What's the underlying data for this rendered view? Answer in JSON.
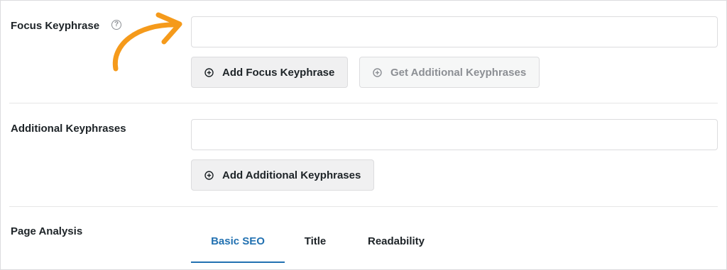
{
  "focus_keyphrase": {
    "label": "Focus Keyphrase",
    "help_icon": "question-mark-icon",
    "input_value": "",
    "input_placeholder": "",
    "add_button_label": "Add Focus Keyphrase",
    "get_additional_button_label": "Get Additional Keyphrases"
  },
  "additional_keyphrases": {
    "label": "Additional Keyphrases",
    "input_value": "",
    "input_placeholder": "",
    "add_button_label": "Add Additional Keyphrases"
  },
  "page_analysis": {
    "label": "Page Analysis",
    "tabs": [
      {
        "label": "Basic SEO",
        "active": true
      },
      {
        "label": "Title",
        "active": false
      },
      {
        "label": "Readability",
        "active": false
      }
    ]
  },
  "colors": {
    "accent": "#2271b1",
    "arrow": "#f59a1b",
    "button_bg": "#f0f0f1",
    "border": "#dcdcde"
  },
  "icons": {
    "add": "plus-circle-icon",
    "annotation": "curved-arrow-icon"
  }
}
